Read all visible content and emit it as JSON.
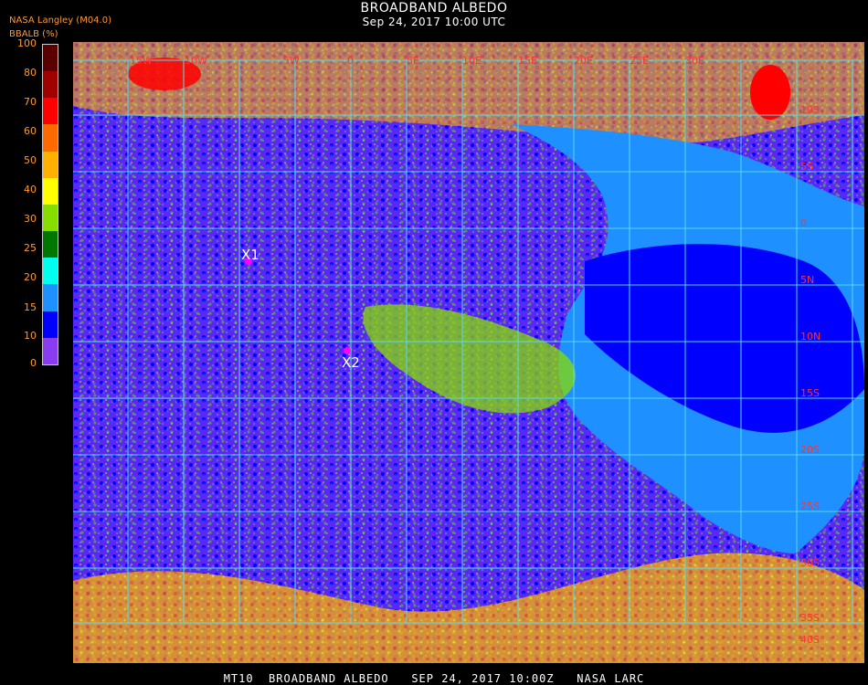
{
  "header": {
    "title": "BROADBAND ALBEDO",
    "subtitle": "Sep 24, 2017 10:00 UTC",
    "credit": "NASA Langley (M04.0)"
  },
  "colorbar": {
    "label": "BBALB (%)",
    "ticks": [
      "100",
      "80",
      "70",
      "60",
      "50",
      "40",
      "30",
      "25",
      "20",
      "15",
      "10",
      "0"
    ],
    "colors": [
      "#5a0000",
      "#a00000",
      "#ff0000",
      "#ff6a00",
      "#ffb000",
      "#ffff00",
      "#88dd00",
      "#007700",
      "#00ffee",
      "#1e90ff",
      "#0000ff",
      "#8a3cf0"
    ]
  },
  "map": {
    "markers": [
      {
        "label": "X1",
        "color": "#ff00ff"
      },
      {
        "label": "X2",
        "color": "#ff00ff"
      }
    ],
    "lon_labels": [
      "15W",
      "10W",
      "5W",
      "0",
      "5E",
      "10E",
      "15E",
      "20E",
      "25E",
      "30E"
    ],
    "lat_labels": [
      "10S",
      "5S",
      "0",
      "5N",
      "10N",
      "15S",
      "20S",
      "25S",
      "30S",
      "35S",
      "40S"
    ]
  },
  "footer": {
    "caption": "MT10  BROADBAND ALBEDO   SEP 24, 2017 10:00Z   NASA LARC"
  }
}
